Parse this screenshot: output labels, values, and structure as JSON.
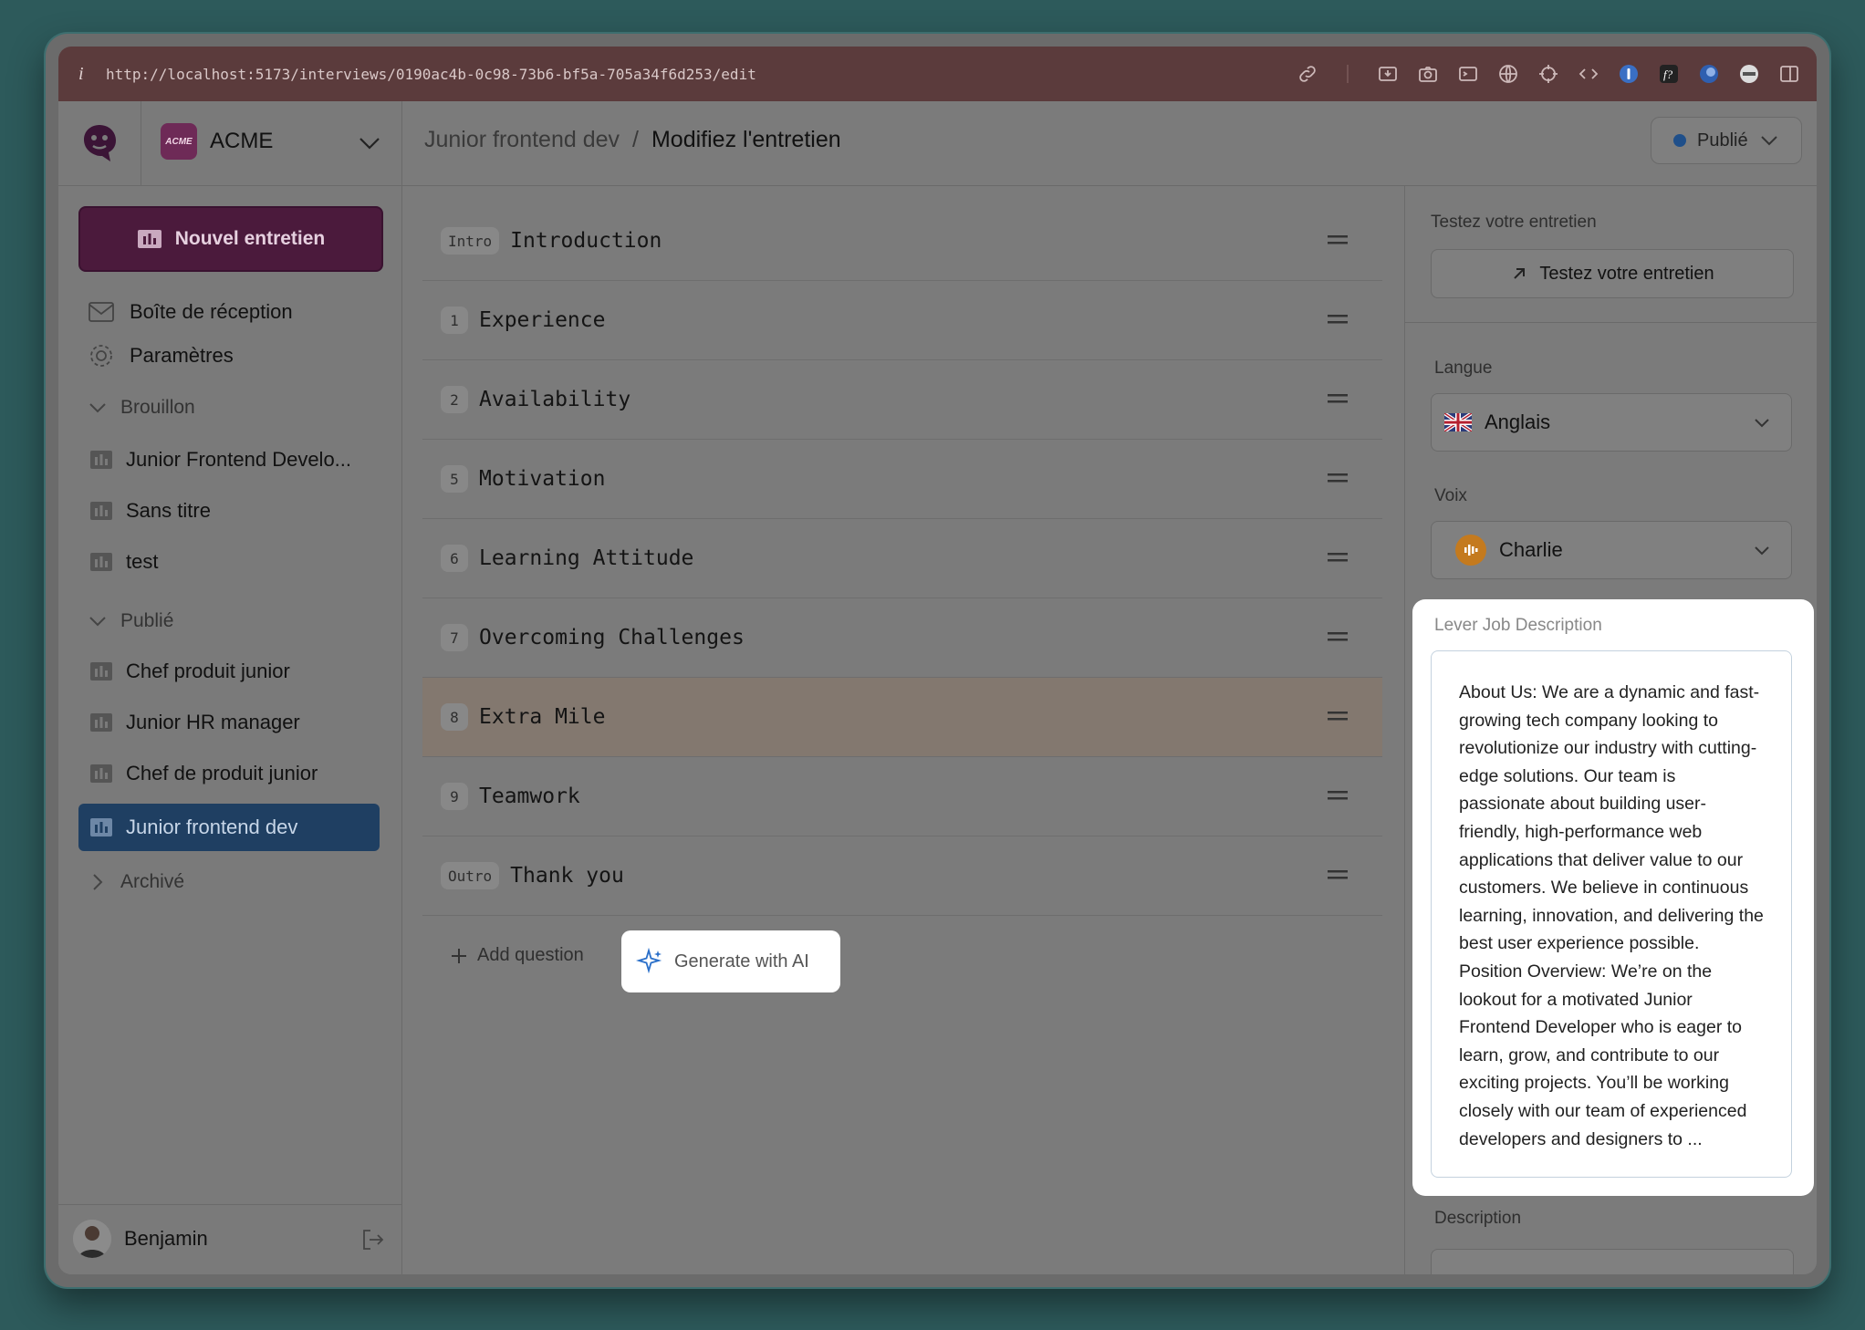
{
  "browser": {
    "url": "http://localhost:5173/interviews/0190ac4b-0c98-73b6-bf5a-705a34f6d253/edit",
    "info_glyph": "i"
  },
  "org": {
    "badge": "ACME",
    "name": "ACME"
  },
  "sidebar": {
    "new_button": "Nouvel entretien",
    "nav": [
      {
        "label": "Boîte de réception",
        "icon": "inbox-icon"
      },
      {
        "label": "Paramètres",
        "icon": "gear-icon"
      }
    ],
    "sections": [
      {
        "title": "Brouillon",
        "items": [
          "Junior Frontend Develo...",
          "Sans titre",
          "test"
        ]
      },
      {
        "title": "Publié",
        "items": [
          "Chef produit junior",
          "Junior HR manager",
          "Chef de produit junior",
          "Junior frontend dev"
        ]
      },
      {
        "title": "Archivé",
        "items": []
      }
    ],
    "active_item": "Junior frontend dev",
    "user": "Benjamin"
  },
  "header": {
    "crumb_parent": "Junior frontend dev",
    "crumb_sep": "/",
    "crumb_current": "Modifiez l'entretien",
    "status": "Publié",
    "status_color": "#1f4f8a"
  },
  "questions": [
    {
      "badge": "Intro",
      "label": "Introduction"
    },
    {
      "badge": "1",
      "label": "Experience"
    },
    {
      "badge": "2",
      "label": "Availability"
    },
    {
      "badge": "5",
      "label": "Motivation"
    },
    {
      "badge": "6",
      "label": "Learning Attitude"
    },
    {
      "badge": "7",
      "label": "Overcoming Challenges"
    },
    {
      "badge": "8",
      "label": "Extra Mile"
    },
    {
      "badge": "9",
      "label": "Teamwork"
    },
    {
      "badge": "Outro",
      "label": "Thank you"
    }
  ],
  "actions": {
    "add_question": "Add question",
    "generate_ai": "Generate with AI"
  },
  "right_panel": {
    "test_label": "Testez votre entretien",
    "test_button": "Testez votre entretien",
    "language_label": "Langue",
    "language_value": "Anglais",
    "voice_label": "Voix",
    "voice_value": "Charlie",
    "jd_title": "Lever Job Description",
    "jd_text": "About Us: We are a dynamic and fast-growing tech company looking to revolutionize our industry with cutting-edge solutions. Our team is passionate about building user-friendly, high-performance web applications that deliver value to our customers. We believe in continuous learning, innovation, and delivering the best user experience possible. Position Overview: We’re on the lookout for a motivated Junior Frontend Developer who is eager to learn, grow, and contribute to our exciting projects. You’ll be working closely with our team of experienced developers and designers to ...",
    "description_label": "Description"
  },
  "colors": {
    "brand": "#4b1a3c",
    "active": "#1f3f62",
    "background": "#2d5a5b"
  }
}
